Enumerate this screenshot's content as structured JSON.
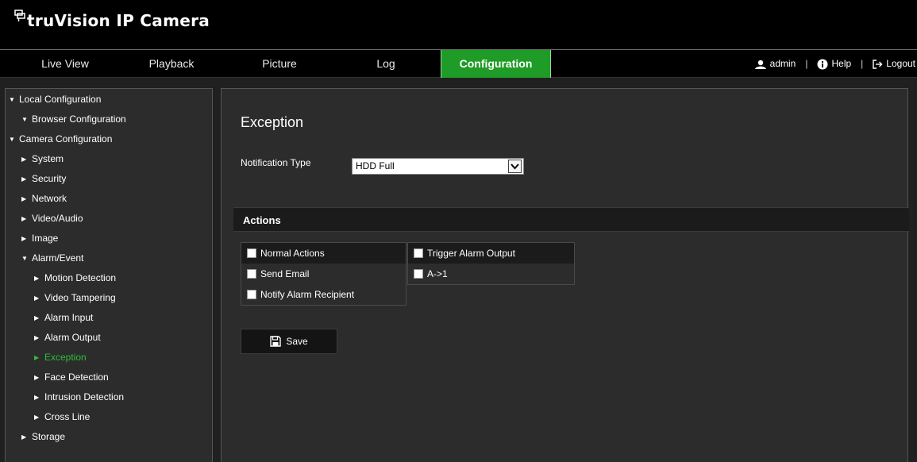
{
  "brand": {
    "title": "truVision IP Camera"
  },
  "nav": {
    "tabs": [
      {
        "label": "Live View"
      },
      {
        "label": "Playback"
      },
      {
        "label": "Picture"
      },
      {
        "label": "Log"
      },
      {
        "label": "Configuration"
      }
    ],
    "active": "Configuration",
    "user": "admin",
    "help": "Help",
    "logout": "Logout",
    "separator": "|"
  },
  "sidebar": {
    "items": [
      {
        "label": "Local Configuration",
        "arrow": "▼"
      },
      {
        "label": "Browser Configuration",
        "arrow": "▼"
      },
      {
        "label": "Camera Configuration",
        "arrow": "▼"
      },
      {
        "label": "System",
        "arrow": "▶"
      },
      {
        "label": "Security",
        "arrow": "▶"
      },
      {
        "label": "Network",
        "arrow": "▶"
      },
      {
        "label": "Video/Audio",
        "arrow": "▶"
      },
      {
        "label": "Image",
        "arrow": "▶"
      },
      {
        "label": "Alarm/Event",
        "arrow": "▼"
      },
      {
        "label": "Motion Detection",
        "arrow": "▶"
      },
      {
        "label": "Video Tampering",
        "arrow": "▶"
      },
      {
        "label": "Alarm Input",
        "arrow": "▶"
      },
      {
        "label": "Alarm Output",
        "arrow": "▶"
      },
      {
        "label": "Exception",
        "arrow": "▶"
      },
      {
        "label": "Face Detection",
        "arrow": "▶"
      },
      {
        "label": "Intrusion Detection",
        "arrow": "▶"
      },
      {
        "label": "Cross Line",
        "arrow": "▶"
      },
      {
        "label": "Storage",
        "arrow": "▶"
      }
    ],
    "selected": "Exception"
  },
  "main": {
    "title": "Exception",
    "notification_label": "Notification Type",
    "notification_value": "HDD Full",
    "actions_title": "Actions",
    "normal_actions": {
      "header": "Normal Actions",
      "items": [
        "Send Email",
        "Notify Alarm Recipient"
      ]
    },
    "trigger_alarm": {
      "header": "Trigger Alarm Output",
      "items": [
        "A->1"
      ]
    },
    "save_label": "Save"
  },
  "colors": {
    "accent": "#1f9c27",
    "selected_text": "#2ebd3a",
    "panel": "#2c2c2c",
    "background": "#202020"
  }
}
